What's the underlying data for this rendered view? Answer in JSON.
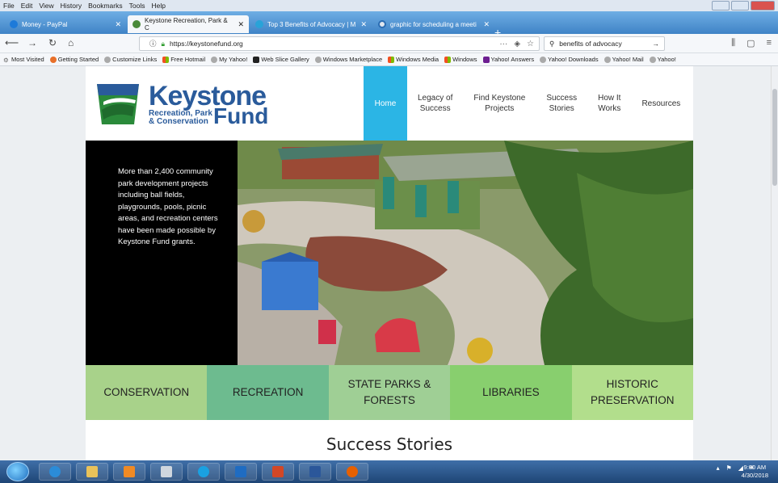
{
  "menubar": {
    "items": [
      "File",
      "Edit",
      "View",
      "History",
      "Bookmarks",
      "Tools",
      "Help"
    ]
  },
  "tabs": [
    {
      "label": "Money - PayPal",
      "active": false
    },
    {
      "label": "Keystone Recreation, Park & C",
      "active": true
    },
    {
      "label": "Top 3 Benefits of Advocacy | M",
      "active": false
    },
    {
      "label": "graphic for scheduling a meeti",
      "active": false
    }
  ],
  "addressbar": {
    "url": "https://keystonefund.org",
    "search_value": "benefits of advocacy"
  },
  "bookmarks": [
    "Most Visited",
    "Getting Started",
    "Customize Links",
    "Free Hotmail",
    "My Yahoo!",
    "Web Slice Gallery",
    "Windows Marketplace",
    "Windows Media",
    "Windows",
    "Yahoo! Answers",
    "Yahoo! Downloads",
    "Yahoo! Mail",
    "Yahoo!"
  ],
  "site": {
    "logo": {
      "line1": "Keystone",
      "line2": "Recreation, Park",
      "line3": "& Conservation",
      "line4": "Fund"
    },
    "nav": [
      {
        "label": "Home",
        "active": true
      },
      {
        "label": "Legacy of\nSuccess",
        "active": false
      },
      {
        "label": "Find Keystone\nProjects",
        "active": false
      },
      {
        "label": "Success\nStories",
        "active": false
      },
      {
        "label": "How It\nWorks",
        "active": false
      },
      {
        "label": "Resources",
        "active": false
      }
    ],
    "hero_text": "More than 2,400 community park development projects including ball fields, playgrounds, pools, picnic areas, and recreation centers have been made possible by Keystone Fund grants.",
    "categories": [
      {
        "label": "CONSERVATION",
        "color": "#a8d28a"
      },
      {
        "label": "RECREATION",
        "color": "#6dbb8f"
      },
      {
        "label": "STATE PARKS &\nFORESTS",
        "color": "#9fcf95"
      },
      {
        "label": "LIBRARIES",
        "color": "#88cf6e"
      },
      {
        "label": "HISTORIC\nPRESERVATION",
        "color": "#b2de8c"
      }
    ],
    "section_title": "Success Stories"
  },
  "taskbar": {
    "time": "9:00 AM",
    "date": "4/30/2018"
  },
  "colors": {
    "nav_active": "#2bb5e5",
    "brand_blue": "#2a5b9b",
    "tab_bar": "#4a8fd0"
  }
}
